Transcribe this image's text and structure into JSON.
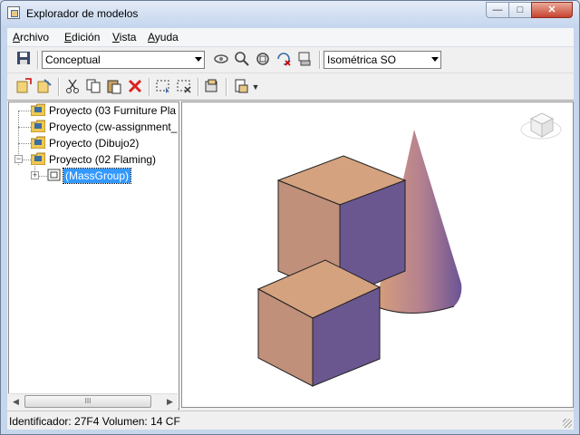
{
  "window": {
    "title": "Explorador de modelos",
    "controls": {
      "minimize": "—",
      "maximize": "□",
      "close": "✕"
    }
  },
  "menu": [
    {
      "label": "Archivo",
      "mnemonic": "A",
      "rest": "rchivo"
    },
    {
      "label": "Edición",
      "mnemonic": "E",
      "rest": "dición"
    },
    {
      "label": "Vista",
      "mnemonic": "V",
      "rest": "ista"
    },
    {
      "label": "Ayuda",
      "mnemonic": "A",
      "rest": "yuda"
    }
  ],
  "toolbar1": {
    "visual_style": "Conceptual",
    "view_direction": "Isométrica SO",
    "icons": [
      "save-icon",
      "orbit-icon",
      "zoom-icon",
      "zoom-extents-icon",
      "reset-view-icon",
      "fit-icon"
    ]
  },
  "toolbar2": {
    "icons": [
      "new-project-icon",
      "open-project-icon",
      "cut-icon",
      "copy-icon",
      "paste-icon",
      "delete-icon",
      "select-icon",
      "clear-selection-icon",
      "properties-icon",
      "export-icon"
    ]
  },
  "tree": [
    {
      "label": "Proyecto (03 Furniture Pla",
      "level": 0,
      "expander": ""
    },
    {
      "label": "Proyecto (cw-assignment_",
      "level": 0,
      "expander": ""
    },
    {
      "label": "Proyecto (Dibujo2)",
      "level": 0,
      "expander": ""
    },
    {
      "label": "Proyecto (02 Flaming)",
      "level": 0,
      "expander": "−"
    },
    {
      "label": "(MassGroup)",
      "level": 1,
      "expander": "+",
      "selected": true
    }
  ],
  "hscroll": {
    "left": "◀",
    "thumb": "III",
    "right": "▶"
  },
  "status": "Identificador: 27F4  Volumen: 14 CF",
  "colors": {
    "selection": "#3399ff",
    "mass_top": "#d4a27e",
    "mass_front": "#c0907a",
    "mass_side": "#6a5790"
  }
}
